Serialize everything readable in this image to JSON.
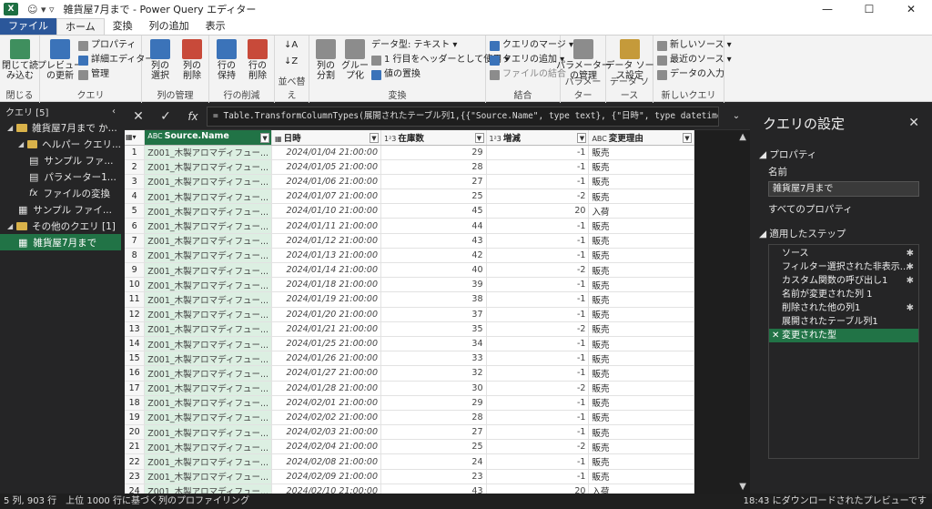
{
  "window": {
    "title": "雑貨屋7月まで - Power Query エディター",
    "sep": "|",
    "minimize": "—",
    "maximize": "☐",
    "close": "✕"
  },
  "tabs": [
    "ファイル",
    "ホーム",
    "変換",
    "列の追加",
    "表示"
  ],
  "ribbon": {
    "close_load": "閉じて読\nみ込む",
    "preview_refresh": "プレビュー\nの更新",
    "properties": "プロパティ",
    "advanced_editor": "詳細エディター",
    "manage": "管理",
    "choose_columns": "列の\n選択",
    "remove_columns": "列の\n削除",
    "keep_rows": "行の\n保持",
    "remove_rows": "行の\n削除",
    "split_column": "列の\n分割",
    "group_by": "グルー\nプ化",
    "data_type": "データ型: テキスト",
    "first_row_header": "1 行目をヘッダーとして使用",
    "replace_values": "値の置換",
    "merge_queries": "クエリのマージ",
    "append_queries": "クエリの追加",
    "combine_files": "ファイルの結合",
    "manage_params": "パラメーター\nの管理",
    "data_source": "データ ソー\nス設定",
    "new_source": "新しいソース",
    "recent_sources": "最近のソース",
    "enter_data": "データの入力",
    "groups": [
      "閉じる",
      "クエリ",
      "列の管理",
      "行の削減",
      "並べ替え",
      "変換",
      "結合",
      "パラメーター",
      "データ ソース",
      "新しいクエリ"
    ]
  },
  "left_pane": {
    "header": "クエリ [5]",
    "items": [
      {
        "label": "雑貨屋7月まで か...",
        "indent": 1,
        "icon": "folder"
      },
      {
        "label": "ヘルパー クエリ...",
        "indent": 2,
        "icon": "folder"
      },
      {
        "label": "サンプル ファ...",
        "indent": 3,
        "icon": "doc"
      },
      {
        "label": "パラメーター1...",
        "indent": 3,
        "icon": "doc"
      },
      {
        "label": "ファイルの変換",
        "indent": 3,
        "icon": "fx"
      },
      {
        "label": "サンプル ファイ...",
        "indent": 2,
        "icon": "table"
      },
      {
        "label": "その他のクエリ [1]",
        "indent": 1,
        "icon": "folder"
      },
      {
        "label": "雑貨屋7月まで",
        "indent": 2,
        "icon": "table",
        "selected": true
      }
    ]
  },
  "formula_bar": {
    "cancel": "✕",
    "commit": "✓",
    "fx": "fx",
    "text": "= Table.TransformColumnTypes(展開されたテーブル列1,{{\"Source.Name\", type text}, {\"日時\", type datetime}, {\"在庫数\","
  },
  "grid": {
    "columns": [
      {
        "type": "ABC",
        "name": "Source.Name"
      },
      {
        "type": "▦",
        "name": "日時"
      },
      {
        "type": "1²3",
        "name": "在庫数"
      },
      {
        "type": "1²3",
        "name": "増減"
      },
      {
        "type": "ABC",
        "name": "変更理由"
      }
    ],
    "rows": [
      [
        "1",
        "Z001_木製アロマディフュー...",
        "2024/01/04 21:00:00",
        "29",
        "-1",
        "販売"
      ],
      [
        "2",
        "Z001_木製アロマディフュー...",
        "2024/01/05 21:00:00",
        "28",
        "-1",
        "販売"
      ],
      [
        "3",
        "Z001_木製アロマディフュー...",
        "2024/01/06 21:00:00",
        "27",
        "-1",
        "販売"
      ],
      [
        "4",
        "Z001_木製アロマディフュー...",
        "2024/01/07 21:00:00",
        "25",
        "-2",
        "販売"
      ],
      [
        "5",
        "Z001_木製アロマディフュー...",
        "2024/01/10 21:00:00",
        "45",
        "20",
        "入荷"
      ],
      [
        "6",
        "Z001_木製アロマディフュー...",
        "2024/01/11 21:00:00",
        "44",
        "-1",
        "販売"
      ],
      [
        "7",
        "Z001_木製アロマディフュー...",
        "2024/01/12 21:00:00",
        "43",
        "-1",
        "販売"
      ],
      [
        "8",
        "Z001_木製アロマディフュー...",
        "2024/01/13 21:00:00",
        "42",
        "-1",
        "販売"
      ],
      [
        "9",
        "Z001_木製アロマディフュー...",
        "2024/01/14 21:00:00",
        "40",
        "-2",
        "販売"
      ],
      [
        "10",
        "Z001_木製アロマディフュー...",
        "2024/01/18 21:00:00",
        "39",
        "-1",
        "販売"
      ],
      [
        "11",
        "Z001_木製アロマディフュー...",
        "2024/01/19 21:00:00",
        "38",
        "-1",
        "販売"
      ],
      [
        "12",
        "Z001_木製アロマディフュー...",
        "2024/01/20 21:00:00",
        "37",
        "-1",
        "販売"
      ],
      [
        "13",
        "Z001_木製アロマディフュー...",
        "2024/01/21 21:00:00",
        "35",
        "-2",
        "販売"
      ],
      [
        "14",
        "Z001_木製アロマディフュー...",
        "2024/01/25 21:00:00",
        "34",
        "-1",
        "販売"
      ],
      [
        "15",
        "Z001_木製アロマディフュー...",
        "2024/01/26 21:00:00",
        "33",
        "-1",
        "販売"
      ],
      [
        "16",
        "Z001_木製アロマディフュー...",
        "2024/01/27 21:00:00",
        "32",
        "-1",
        "販売"
      ],
      [
        "17",
        "Z001_木製アロマディフュー...",
        "2024/01/28 21:00:00",
        "30",
        "-2",
        "販売"
      ],
      [
        "18",
        "Z001_木製アロマディフュー...",
        "2024/02/01 21:00:00",
        "29",
        "-1",
        "販売"
      ],
      [
        "19",
        "Z001_木製アロマディフュー...",
        "2024/02/02 21:00:00",
        "28",
        "-1",
        "販売"
      ],
      [
        "20",
        "Z001_木製アロマディフュー...",
        "2024/02/03 21:00:00",
        "27",
        "-1",
        "販売"
      ],
      [
        "21",
        "Z001_木製アロマディフュー...",
        "2024/02/04 21:00:00",
        "25",
        "-2",
        "販売"
      ],
      [
        "22",
        "Z001_木製アロマディフュー...",
        "2024/02/08 21:00:00",
        "24",
        "-1",
        "販売"
      ],
      [
        "23",
        "Z001_木製アロマディフュー...",
        "2024/02/09 21:00:00",
        "23",
        "-1",
        "販売"
      ],
      [
        "24",
        "Z001_木製アロマディフュー...",
        "2024/02/10 21:00:00",
        "43",
        "20",
        "入荷"
      ]
    ]
  },
  "right_pane": {
    "title": "クエリの設定",
    "close": "✕",
    "properties_header": "プロパティ",
    "name_label": "名前",
    "name_value": "雑貨屋7月まで",
    "all_properties": "すべてのプロパティ",
    "steps_header": "適用したステップ",
    "steps": [
      {
        "label": "ソース",
        "gear": true
      },
      {
        "label": "フィルター選択された非表示...",
        "gear": true
      },
      {
        "label": "カスタム関数の呼び出し1",
        "gear": true
      },
      {
        "label": "名前が変更された列 1",
        "gear": false
      },
      {
        "label": "削除された他の列1",
        "gear": true
      },
      {
        "label": "展開されたテーブル列1",
        "gear": false
      },
      {
        "label": "変更された型",
        "gear": false,
        "selected": true
      }
    ]
  },
  "status": {
    "left": "5 列, 903 行　上位 1000 行に基づく列のプロファイリング",
    "right": "18:43 にダウンロードされたプレビューです"
  }
}
